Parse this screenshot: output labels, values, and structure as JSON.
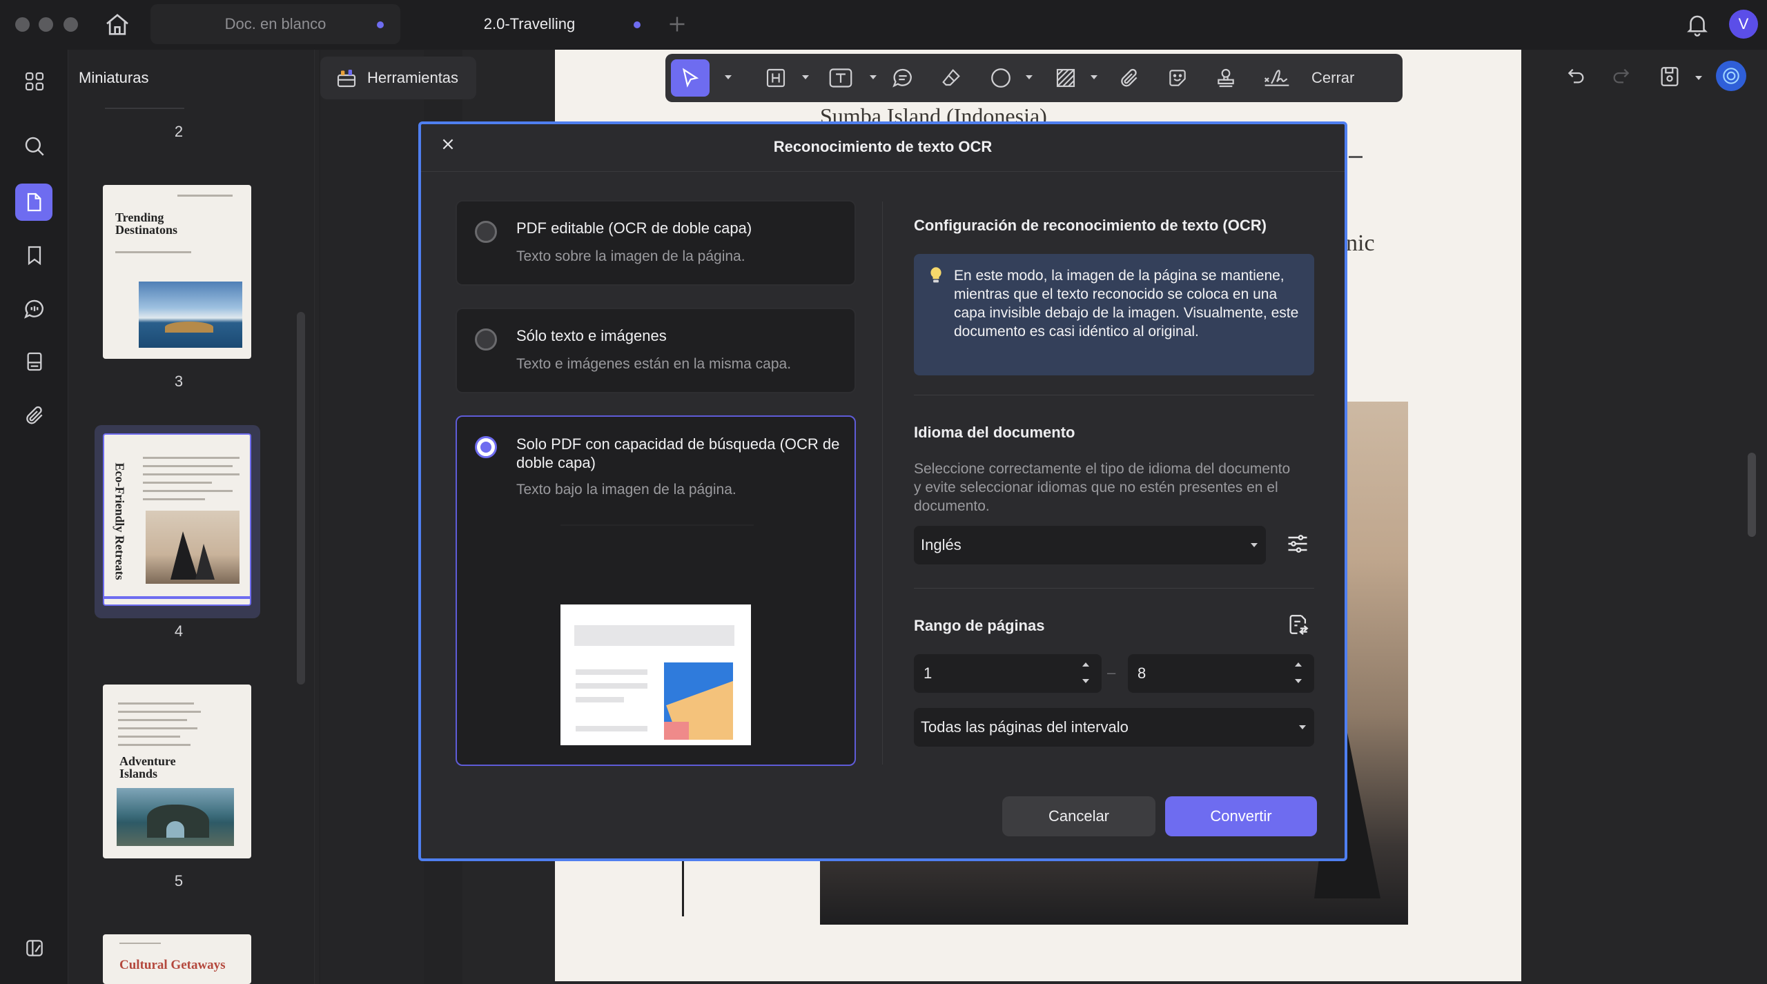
{
  "window": {
    "tabs": [
      {
        "label": "Doc. en blanco"
      },
      {
        "label": "2.0-Travelling"
      }
    ],
    "avatar_letter": "V",
    "accent": "#6e6cf0"
  },
  "panel": {
    "title": "Miniaturas",
    "tools_label": "Herramientas",
    "pages": [
      {
        "number": "2"
      },
      {
        "number": "3",
        "title": "Trending Destinatons"
      },
      {
        "number": "4",
        "title": "Eco-Friendly Retreats"
      },
      {
        "number": "5",
        "title": "Adventure Islands"
      },
      {
        "title": "Cultural Getaways"
      }
    ]
  },
  "toolbar": {
    "close_label": "Cerrar",
    "icons": [
      "select-arrow-icon",
      "heading-icon",
      "textbox-icon",
      "comment-icon",
      "eraser-icon",
      "shape-circle-icon",
      "hatch-area-icon",
      "attachment-icon",
      "sticker-icon",
      "stamp-icon",
      "signature-icon"
    ]
  },
  "document": {
    "heading": "Sumba Island (Indonesia)",
    "fragment": "nic"
  },
  "dialog": {
    "title": "Reconocimiento de texto OCR",
    "options": [
      {
        "title": "PDF editable (OCR de doble capa)",
        "subtitle": "Texto sobre la imagen de la página.",
        "selected": false
      },
      {
        "title": "Sólo texto e imágenes",
        "subtitle": "Texto e imágenes están en la misma capa.",
        "selected": false
      },
      {
        "title": "Solo PDF con capacidad de búsqueda (OCR de doble capa)",
        "subtitle": "Texto bajo la imagen de la página.",
        "selected": true
      }
    ],
    "config_title": "Configuración de reconocimiento de texto (OCR)",
    "info_text": "En este modo, la imagen de la página se mantiene, mientras que el texto reconocido se coloca en una capa invisible debajo de la imagen. Visualmente, este documento es casi idéntico al original.",
    "language_title": "Idioma del documento",
    "language_help": "Seleccione correctamente el tipo de idioma del documento y evite seleccionar idiomas que no estén presentes en el documento.",
    "language_value": "Inglés",
    "range_title": "Rango de páginas",
    "range_from": "1",
    "range_sep": "–",
    "range_to": "8",
    "range_mode": "Todas las páginas del intervalo",
    "cancel_label": "Cancelar",
    "convert_label": "Convertir"
  }
}
